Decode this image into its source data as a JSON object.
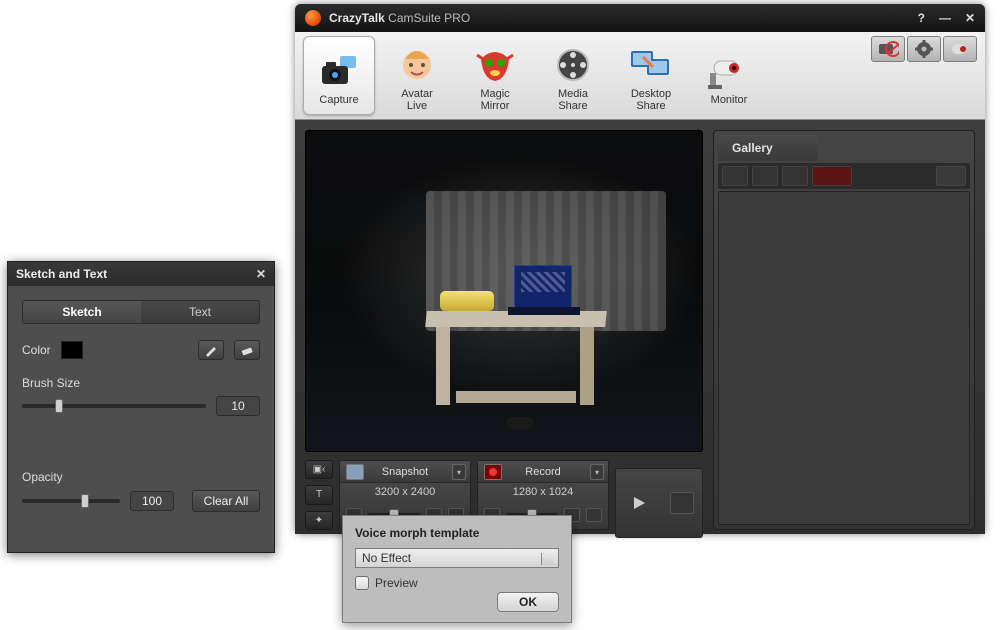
{
  "window": {
    "title_brand": "CrazyTalk",
    "title_product": "CamSuite PRO"
  },
  "toolbar": {
    "items": [
      {
        "label": "Capture",
        "name": "capture",
        "active": true
      },
      {
        "label": "Avatar\nLive",
        "name": "avatar-live",
        "active": false
      },
      {
        "label": "Magic\nMirror",
        "name": "magic-mirror",
        "active": false
      },
      {
        "label": "Media\nShare",
        "name": "media-share",
        "active": false
      },
      {
        "label": "Desktop\nShare",
        "name": "desktop-share",
        "active": false
      },
      {
        "label": "Monitor",
        "name": "monitor",
        "active": false
      }
    ]
  },
  "snapshot": {
    "title": "Snapshot",
    "resolution": "3200 x 2400"
  },
  "record": {
    "title": "Record",
    "resolution": "1280 x 1024"
  },
  "gallery": {
    "title": "Gallery"
  },
  "sketch": {
    "window_title": "Sketch and Text",
    "tab_sketch": "Sketch",
    "tab_text": "Text",
    "color_label": "Color",
    "brush_label": "Brush Size",
    "brush_value": "10",
    "opacity_label": "Opacity",
    "opacity_value": "100",
    "clear_label": "Clear All"
  },
  "voice_morph": {
    "title": "Voice morph template",
    "selected": "No Effect",
    "preview_label": "Preview",
    "ok_label": "OK"
  }
}
